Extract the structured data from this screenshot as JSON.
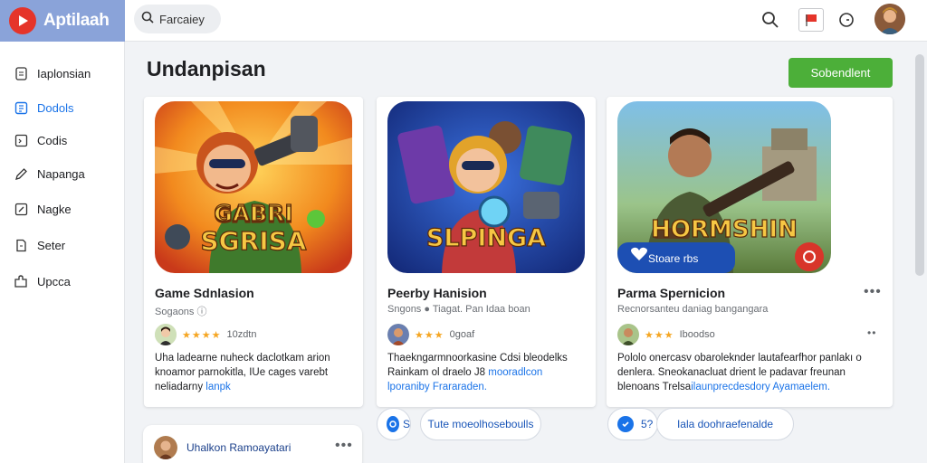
{
  "app": {
    "name": "Aptilaah"
  },
  "search": {
    "placeholder": "Farcaiey"
  },
  "sidebar": {
    "items": [
      {
        "label": "Iaplonsian",
        "icon": "doc-icon"
      },
      {
        "label": "Dodols",
        "icon": "grid-icon",
        "active": true
      },
      {
        "label": "Codis",
        "icon": "code-icon"
      },
      {
        "label": "Napanga",
        "icon": "pen-icon"
      },
      {
        "label": "Nagke",
        "icon": "edit-box-icon"
      },
      {
        "label": "Seter",
        "icon": "file-icon"
      },
      {
        "label": "Upcca",
        "icon": "puzzle-icon"
      }
    ]
  },
  "main": {
    "title": "Undanpisan",
    "primary_button": "Sobendlent",
    "cards": [
      {
        "art_title_1": "GABRI",
        "art_title_2": "SGRISA",
        "name": "Game Sdnlasion",
        "sub": "Sogaons  ⓘ",
        "stars": "★★★★",
        "rating_text": "10zdtn",
        "desc": "Uha ladearne nuheck daclotkam arion knoamor parnokitla, IUe cages varebt neliadarny ",
        "desc_link": "lanpk"
      },
      {
        "art_title_1": "SLPINGA",
        "name": "Peerby Hanision",
        "sub": "Sngons  ● Tiagat. Pan Idaa boan",
        "stars": "★★★",
        "rating_text": "0goaf",
        "desc": "Thaekngarmnoorkasine Cdsi bleodelks Rainkam ol draelo J8 ",
        "desc_link": "mooradlcon lporaniby Frararaden."
      },
      {
        "art_title_1": "HORMSHIN",
        "art_badge": "Stoare rbs",
        "name": "Parma Spernicion",
        "sub": "Recnorsanteu daniag bangangara",
        "stars": "★★★",
        "rating_text": "Iboodso",
        "desc": "Pololo onercasv obaroleknder lautafearfhor panlakı o denlera. Sneokanacluat drient le padavar freunan blenoans Trelsa",
        "desc_link": "ilaunprecdesdory Ayamaelem."
      }
    ],
    "pills": [
      {
        "round_label": "S",
        "label": "Tute moeolhoseboulls"
      },
      {
        "round_label": "5?",
        "label": "Iala doohraefenalde"
      }
    ],
    "bottom_card": {
      "name": "Uhalkon Ramoayatari"
    }
  }
}
